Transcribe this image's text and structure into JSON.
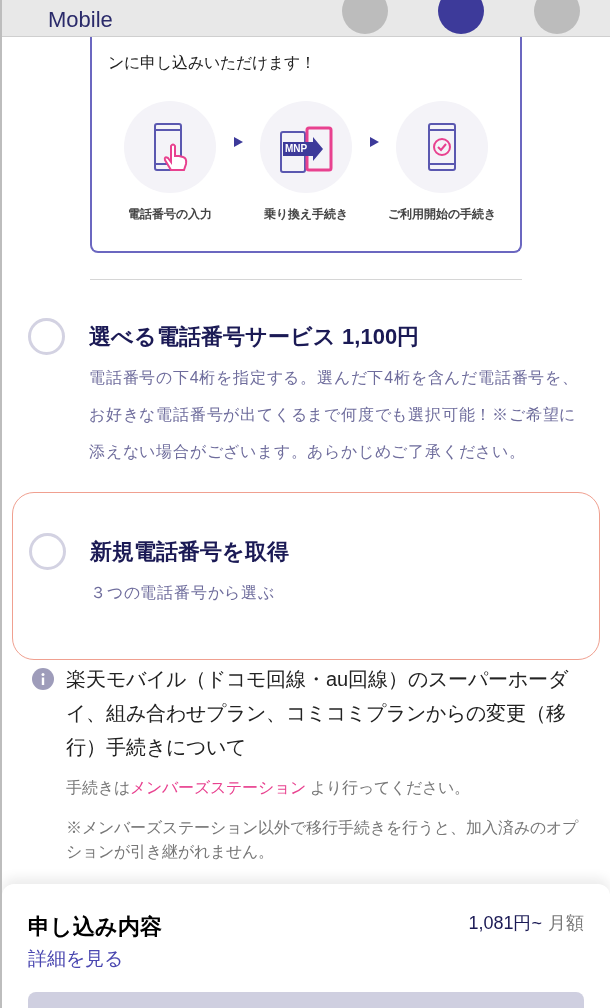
{
  "header": {
    "logo": "Mobile",
    "steps": [
      {
        "selected": false
      },
      {
        "selected": true
      },
      {
        "selected": false
      }
    ]
  },
  "mnp_box": {
    "text": "ンに申し込みいただけます！",
    "steps": [
      {
        "kind": "input",
        "label": "電話番号の入力"
      },
      {
        "kind": "transfer",
        "label": "乗り換え手続き",
        "badge": "MNP"
      },
      {
        "kind": "done",
        "label": "ご利用開始の手続き"
      }
    ]
  },
  "options": [
    {
      "title": "選べる電話番号サービス 1,100円",
      "description": "電話番号の下4桁を指定する。選んだ下4桁を含んだ電話番号を、お好きな電話番号が出てくるまで何度でも選択可能！※ご希望に添えない場合がございます。あらかじめご了承ください。",
      "selected": false,
      "highlighted": false
    },
    {
      "title": "新規電話番号を取得",
      "description": "３つの電話番号から選ぶ",
      "selected": false,
      "highlighted": true
    }
  ],
  "notice": {
    "title": "楽天モバイル（ドコモ回線・au回線）のスーパーホーダイ、組み合わせプラン、コミコミプランからの変更（移行）手続きについて",
    "text_before": "手続きは",
    "link": "メンバーズステーション",
    "text_after": " より行ってください。",
    "note": "※メンバーズステーション以外で移行手続きを行うと、加入済みのオプションが引き継がれません。"
  },
  "summary": {
    "title": "申し込み内容",
    "price": "1,081円~",
    "period": "月額",
    "details_link": "詳細を見る"
  }
}
